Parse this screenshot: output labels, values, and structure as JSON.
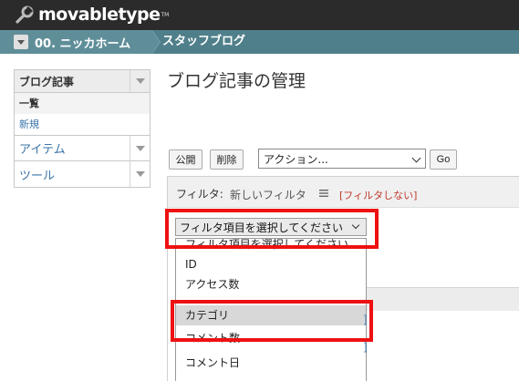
{
  "brand": {
    "name": "movabletype",
    "tm": "TM"
  },
  "breadcrumb": {
    "site": "00. ニッカホーム",
    "blog": "スタッフブログ"
  },
  "sidebar": {
    "section": "ブログ記事",
    "sub_items": [
      "一覧",
      "新規"
    ],
    "rows": [
      "アイテム",
      "ツール"
    ]
  },
  "main": {
    "title": "ブログ記事の管理",
    "buttons": {
      "publish": "公開",
      "delete": "削除",
      "go": "Go"
    },
    "action_select": "アクション..."
  },
  "filter": {
    "label": "フィルタ:",
    "current": "新しいフィルタ",
    "clear": "[フィルタしない]",
    "select_value": "フィルタ項目を選択してください",
    "options": [
      "フィルタ項目を選択してください",
      "ID",
      "アクセス数",
      "カテゴリ",
      "コメント数",
      "コメント日"
    ],
    "selected_index": 3
  },
  "colors": {
    "highlight": "#ee1111",
    "topbar": "#2b2b2b",
    "crumbbar": "#4f7f8a",
    "link": "#3b74a8"
  }
}
